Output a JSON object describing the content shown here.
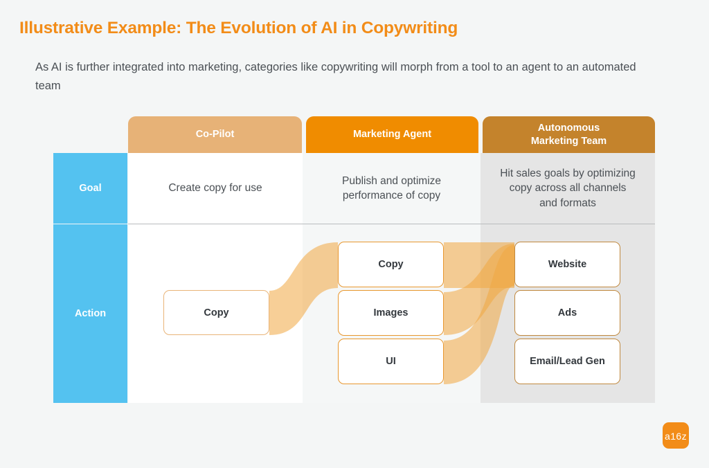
{
  "page": {
    "title": "Illustrative Example: The Evolution of AI in Copywriting",
    "subtitle": "As AI is further integrated into marketing, categories like copywriting will morph from a tool to an agent to an automated team"
  },
  "brand": {
    "logo_text": "a16z",
    "logo_color": "#F28C18"
  },
  "colors": {
    "title": "#F28C18",
    "body_text": "#4b5055",
    "row_label_bg": "#54C2F0",
    "col_copilot": "#E7B277",
    "col_agent": "#F08C00",
    "col_autonomous": "#C4832C",
    "ribbon": "#F2A93B",
    "page_bg": "#f4f6f6"
  },
  "matrix": {
    "columns": [
      {
        "key": "copilot",
        "label": "Co-Pilot"
      },
      {
        "key": "agent",
        "label": "Marketing Agent"
      },
      {
        "key": "autonomous",
        "label": "Autonomous\nMarketing Team"
      }
    ],
    "column_labels": {
      "copilot": "Co-Pilot",
      "agent": "Marketing Agent",
      "autonomous_line1": "Autonomous",
      "autonomous_line2": "Marketing Team"
    },
    "rows": [
      {
        "key": "goal",
        "label": "Goal"
      },
      {
        "key": "action",
        "label": "Action"
      }
    ],
    "row_labels": {
      "goal": "Goal",
      "action": "Action"
    },
    "goal": {
      "copilot": "Create copy for use",
      "agent_line1": "Publish and optimize",
      "agent_line2": "performance of copy",
      "autonomous_line1": "Hit sales goals by optimizing",
      "autonomous_line2": "copy across all channels",
      "autonomous_line3": "and formats"
    },
    "action": {
      "copilot_nodes": [
        "Copy"
      ],
      "agent_nodes": [
        "Copy",
        "Images",
        "UI"
      ],
      "autonomous_nodes": [
        "Website",
        "Ads",
        "Email/Lead Gen"
      ],
      "node_labels": {
        "copilot_copy": "Copy",
        "agent_copy": "Copy",
        "agent_images": "Images",
        "agent_ui": "UI",
        "auto_website": "Website",
        "auto_ads": "Ads",
        "auto_email": "Email/Lead Gen"
      }
    }
  },
  "chart_data": {
    "type": "diagram",
    "diagram_kind": "sankey-flow-matrix",
    "title": "Illustrative Example: The Evolution of AI in Copywriting",
    "stages": [
      "Co-Pilot",
      "Marketing Agent",
      "Autonomous Marketing Team"
    ],
    "nodes": [
      {
        "id": "copilot-copy",
        "stage": "Co-Pilot",
        "label": "Copy"
      },
      {
        "id": "agent-copy",
        "stage": "Marketing Agent",
        "label": "Copy"
      },
      {
        "id": "agent-images",
        "stage": "Marketing Agent",
        "label": "Images"
      },
      {
        "id": "agent-ui",
        "stage": "Marketing Agent",
        "label": "UI"
      },
      {
        "id": "auto-website",
        "stage": "Autonomous Marketing Team",
        "label": "Website"
      },
      {
        "id": "auto-ads",
        "stage": "Autonomous Marketing Team",
        "label": "Ads"
      },
      {
        "id": "auto-email",
        "stage": "Autonomous Marketing Team",
        "label": "Email/Lead Gen"
      }
    ],
    "links": [
      {
        "source": "copilot-copy",
        "target": "agent-copy"
      },
      {
        "source": "agent-copy",
        "target": "auto-website"
      },
      {
        "source": "agent-images",
        "target": "auto-website"
      },
      {
        "source": "agent-ui",
        "target": "auto-website"
      }
    ]
  }
}
